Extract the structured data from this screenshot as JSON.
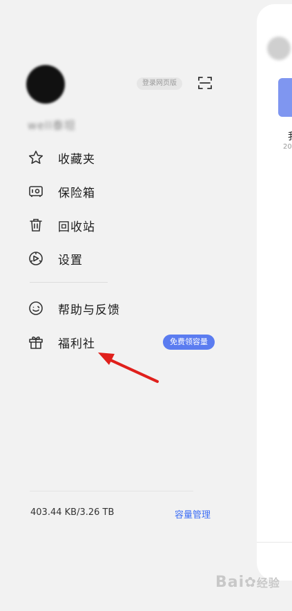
{
  "drawer": {
    "username": "well泰坦",
    "web_login_label": "登录网页版",
    "menu": [
      {
        "label": "收藏夹",
        "icon": "star-icon"
      },
      {
        "label": "保险箱",
        "icon": "safe-icon"
      },
      {
        "label": "回收站",
        "icon": "trash-icon"
      },
      {
        "label": "设置",
        "icon": "settings-icon"
      },
      {
        "label": "帮助与反馈",
        "icon": "smile-icon"
      },
      {
        "label": "福利社",
        "icon": "gift-icon"
      }
    ],
    "free_space_badge": "免费领容量",
    "storage_usage": "403.44 KB/3.26 TB",
    "manage_link": "容量管理"
  },
  "main_screen": {
    "partial_title": "我",
    "partial_date": "20"
  },
  "watermark": {
    "text": "Bai",
    "text2": "经验"
  },
  "colors": {
    "accent": "#3d6ef5",
    "badge": "#5b7cf0",
    "background": "#f2f2f2",
    "annotation_arrow": "#e0201c"
  }
}
